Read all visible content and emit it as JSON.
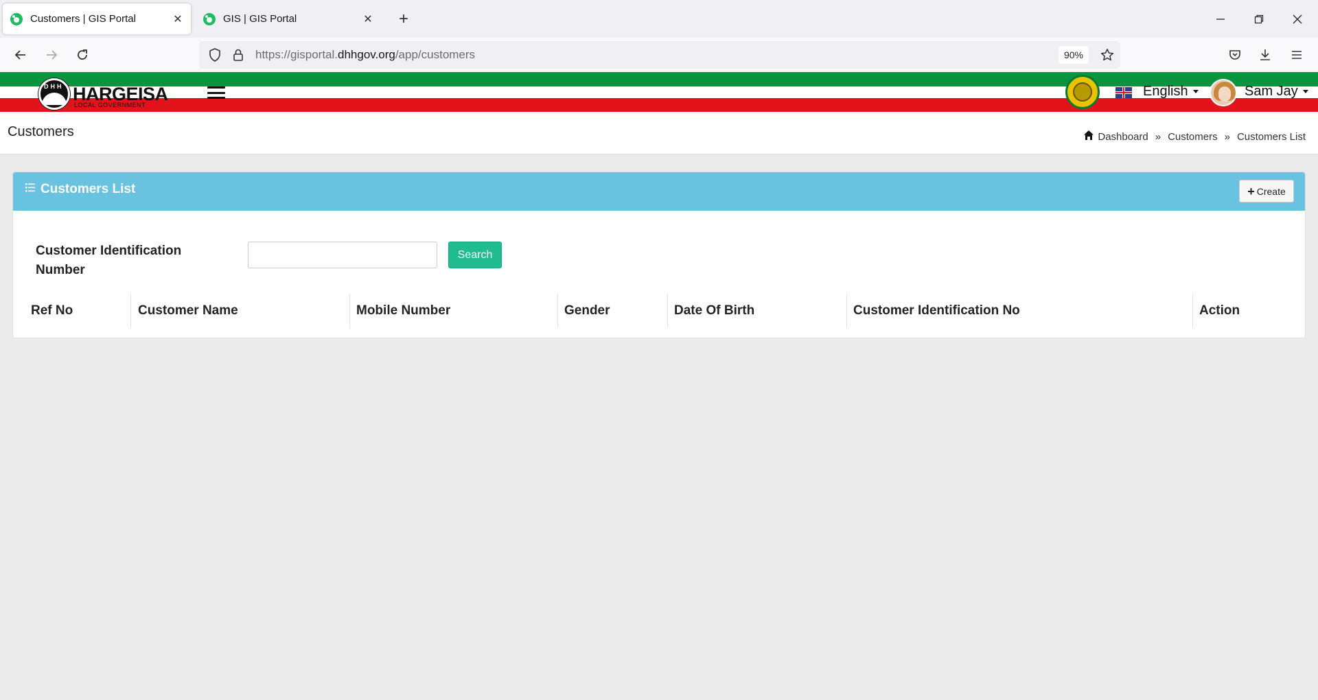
{
  "browser": {
    "tabs": [
      {
        "title": "Customers | GIS Portal",
        "active": true
      },
      {
        "title": "GIS | GIS Portal",
        "active": false
      }
    ],
    "url_prefix": "https://gisportal.",
    "url_domain": "dhhgov.org",
    "url_path": "/app/customers",
    "zoom": "90%"
  },
  "header": {
    "logo_name": "HARGEISA",
    "logo_sub": "LOCAL GOVERNMENT",
    "logo_letters": "DHH",
    "language": "English",
    "user_name": "Sam Jay",
    "colors": {
      "green": "#0a9440",
      "red": "#e2131a"
    }
  },
  "page": {
    "title": "Customers",
    "breadcrumb": [
      "Dashboard",
      "Customers",
      "Customers List"
    ],
    "breadcrumb_separator": "»"
  },
  "card": {
    "title": "Customers List",
    "create_label": "Create",
    "header_color": "#69c3e0"
  },
  "search": {
    "label": "Customer Identification Number",
    "input_value": "",
    "button_label": "Search",
    "button_color": "#1ebc8f"
  },
  "table": {
    "columns": [
      "Ref No",
      "Customer Name",
      "Mobile Number",
      "Gender",
      "Date Of Birth",
      "Customer Identification No",
      "Action"
    ],
    "rows": []
  }
}
